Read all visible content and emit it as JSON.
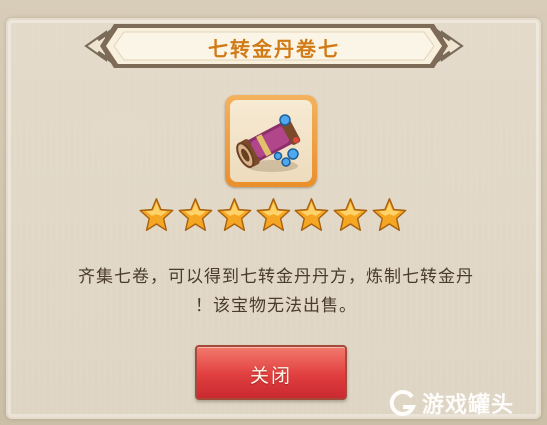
{
  "dialog": {
    "title": "七转金丹卷七",
    "star_count": 7,
    "stars_max": 7,
    "description_line1": "齐集七卷，可以得到七转金丹丹方，炼制七转金丹",
    "description_line2": "！该宝物无法出售。",
    "close_label": "关闭"
  },
  "item": {
    "icon": "scroll-icon"
  },
  "watermark": {
    "text": "游戏罐头"
  },
  "colors": {
    "title": "#d07a18",
    "star": "#f5a623",
    "button": "#e13f3f",
    "text": "#4a3b2b",
    "item_frame": "#ea8f2c"
  }
}
